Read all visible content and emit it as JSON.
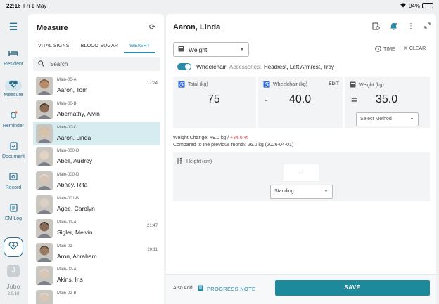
{
  "status_bar": {
    "time": "22:16",
    "date": "Fri 1 May",
    "battery": "94%"
  },
  "nav": {
    "items": [
      {
        "label": "Resident",
        "icon": "bed-icon"
      },
      {
        "label": "Measure",
        "icon": "heart-pulse-icon"
      },
      {
        "label": "Reminder",
        "icon": "bell-icon"
      },
      {
        "label": "Document",
        "icon": "document-icon"
      },
      {
        "label": "Record",
        "icon": "record-icon"
      },
      {
        "label": "EM Log",
        "icon": "em-log-icon"
      }
    ],
    "avatar_initial": "J",
    "brand": "Jubo",
    "version": "2.0.10"
  },
  "list_panel": {
    "title": "Measure",
    "tabs": [
      "VITAL SIGNS",
      "BLOOD SUGAR",
      "WEIGHT"
    ],
    "search_placeholder": "Search",
    "patients": [
      {
        "room": "Main-00-A",
        "name": "Aaron, Tom",
        "time": "17:24"
      },
      {
        "room": "Main-00-B",
        "name": "Abernathy, Alvin",
        "time": ""
      },
      {
        "room": "Main-00-C",
        "name": "Aaron, Linda",
        "time": ""
      },
      {
        "room": "Main-000-D",
        "name": "Abell, Audrey",
        "time": ""
      },
      {
        "room": "Main-000-D",
        "name": "Abney, Rita",
        "time": ""
      },
      {
        "room": "Main-001-B",
        "name": "Agee, Carolyn",
        "time": ""
      },
      {
        "room": "Main-01-A",
        "name": "Sigler, Melvin",
        "time": "21:47"
      },
      {
        "room": "Main-01-",
        "name": "Aron, Abraham",
        "time": "20:11"
      },
      {
        "room": "Main-02-A",
        "name": "Akins, Iris",
        "time": ""
      },
      {
        "room": "Main-02-B",
        "name": "",
        "time": ""
      }
    ]
  },
  "main": {
    "patient_name": "Aaron, Linda",
    "measure_type": "Weight",
    "time_label": "TIME",
    "clear_label": "CLEAR",
    "wheelchair_label": "Wheelchair",
    "accessories_label": "Accessories:",
    "accessories_value": "Headrest, Left Armrest, Tray",
    "total": {
      "label": "Total (kg)",
      "value": "75"
    },
    "wheelchair": {
      "label": "Wheelchair (kg)",
      "edit": "EDIT",
      "operator": "-",
      "value": "40.0"
    },
    "weight": {
      "label": "Weight (kg)",
      "operator": "=",
      "value": "35.0",
      "method_placeholder": "Select Method"
    },
    "weight_change_text": "Weight Change: +9.0 kg / ",
    "weight_change_pct": "+34.6 %",
    "compare_text": "Compared to the previous month: 26.0 kg (2026-04-01)",
    "height": {
      "label": "Height (cm)",
      "value": "--",
      "position": "Standing"
    },
    "also_add_label": "Also Add:",
    "progress_note_label": "PROGRESS NOTE",
    "save_label": "SAVE"
  }
}
